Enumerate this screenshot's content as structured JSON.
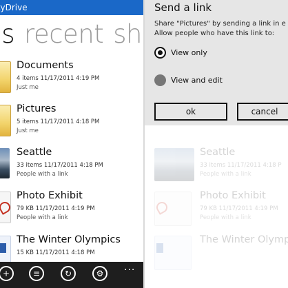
{
  "app": {
    "title": "kyDrive"
  },
  "pivot": {
    "items": [
      "es",
      "recent",
      "sha"
    ]
  },
  "files": [
    {
      "name": "Documents",
      "meta": "4 items  11/17/2011 4:19 PM",
      "sharing": "Just me",
      "kind": "folder"
    },
    {
      "name": "Pictures",
      "meta": "5 items  11/17/2011 4:18 PM",
      "sharing": "Just me",
      "kind": "folder"
    },
    {
      "name": "Seattle",
      "meta": "33 items  11/17/2011 4:18 PM",
      "sharing": "People with a link",
      "kind": "photo-folder"
    },
    {
      "name": "Photo Exhibit",
      "meta": "79 KB  11/17/2011 4:19 PM",
      "sharing": "People with a link",
      "kind": "pdf"
    },
    {
      "name": "The Winter Olympics",
      "meta": "15 KB  11/17/2011 4:18 PM",
      "sharing": "",
      "kind": "word"
    }
  ],
  "faded_files": [
    {
      "name": "Seattle",
      "meta": "33 items  11/17/2011 4:18 P",
      "sharing": "People with a link"
    },
    {
      "name": "Photo Exhibit",
      "meta": "79 KB  11/17/2011 4:19 PM",
      "sharing": "People with a link"
    },
    {
      "name": "The Winter Olympic",
      "meta": "",
      "sharing": ""
    }
  ],
  "appbar": {
    "buttons": [
      "add-icon",
      "select-icon",
      "sync-icon",
      "settings-icon"
    ],
    "more": "..."
  },
  "dialog": {
    "title": "Send a link",
    "body_line1": "Share \"Pictures\" by sending a link in e",
    "body_line2": "Allow people who have this link to:",
    "option_view_only": "View only",
    "option_view_edit": "View and edit",
    "ok_label": "ok",
    "cancel_label": "cancel"
  },
  "colors": {
    "titlebar": "#1a68c8",
    "appbar": "#1e1e1e",
    "dialog": "#e6e6e6"
  }
}
